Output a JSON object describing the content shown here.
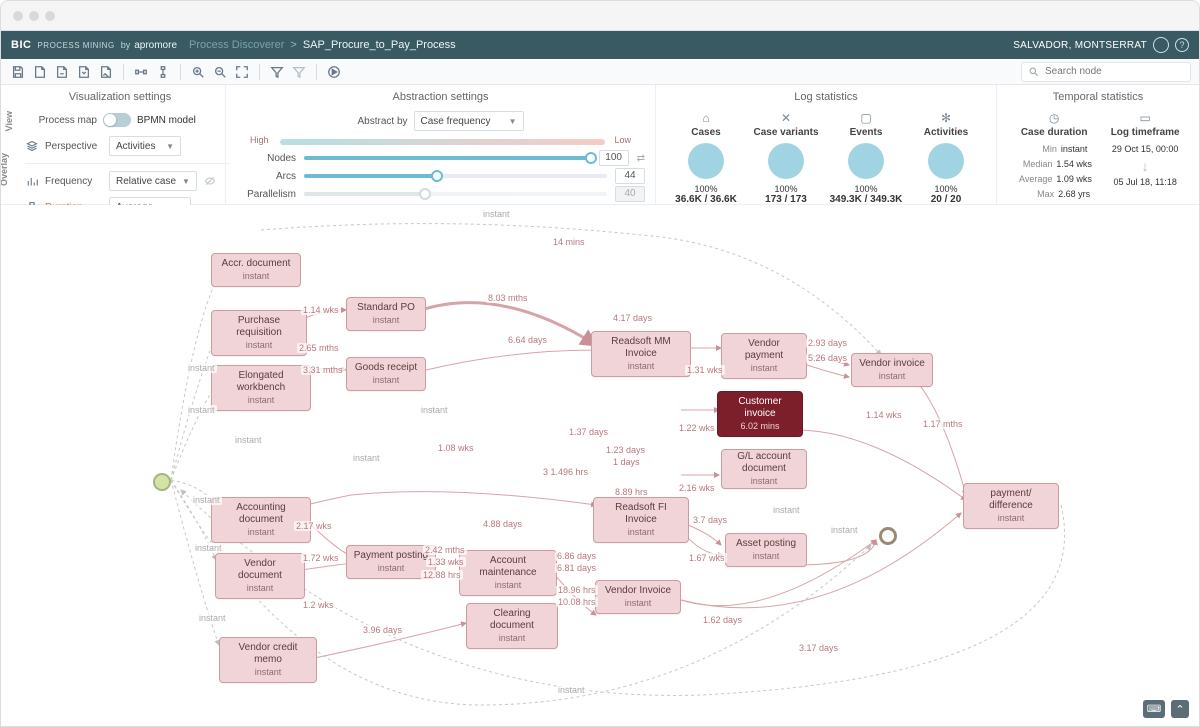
{
  "header": {
    "brand": "BIC",
    "brand_sub": "PROCESS MINING",
    "by": "by",
    "vendor": "apromore",
    "crumb1": "Process Discoverer",
    "crumb_sep": ">",
    "crumb2": "SAP_Procure_to_Pay_Process",
    "user": "SALVADOR, MONTSERRAT",
    "help": "?"
  },
  "toolbar": {
    "search_placeholder": "Search node"
  },
  "viz": {
    "title": "Visualization settings",
    "side_view": "View",
    "side_overlay": "Overlay",
    "process_map_label": "Process map",
    "bpmn_label": "BPMN model",
    "perspective_label": "Perspective",
    "perspective_value": "Activities",
    "frequency_label": "Frequency",
    "frequency_value": "Relative case",
    "duration_label": "Duration",
    "duration_value": "Average"
  },
  "abstr": {
    "title": "Abstraction settings",
    "abstract_by": "Abstract by",
    "abstract_by_value": "Case frequency",
    "high": "High",
    "low": "Low",
    "nodes_label": "Nodes",
    "nodes_value": "100",
    "arcs_label": "Arcs",
    "arcs_value": "44",
    "para_label": "Parallelism",
    "para_value": "40"
  },
  "logstats": {
    "title": "Log statistics",
    "cases": {
      "label": "Cases",
      "pct": "100%",
      "value": "36.6K / 36.6K"
    },
    "variants": {
      "label": "Case variants",
      "pct": "100%",
      "value": "173 / 173"
    },
    "events": {
      "label": "Events",
      "pct": "100%",
      "value": "349.3K / 349.3K"
    },
    "activities": {
      "label": "Activities",
      "pct": "100%",
      "value": "20 / 20"
    }
  },
  "temp": {
    "title": "Temporal statistics",
    "duration": {
      "label": "Case duration",
      "min_k": "Min",
      "min_v": "instant",
      "median_k": "Median",
      "median_v": "1.54 wks",
      "avg_k": "Average",
      "avg_v": "1.09 wks",
      "max_k": "Max",
      "max_v": "2.68 yrs"
    },
    "timeframe": {
      "label": "Log timeframe",
      "start": "29 Oct 15, 00:00",
      "end": "05 Jul 18, 11:18"
    }
  },
  "nodes": {
    "accr_doc": {
      "name": "Accr. document",
      "sub": "instant"
    },
    "purch_req": {
      "name": "Purchase requisition",
      "sub": "instant"
    },
    "elong_wb": {
      "name": "Elongated workbench",
      "sub": "instant"
    },
    "std_po": {
      "name": "Standard PO",
      "sub": "instant"
    },
    "goods_rec": {
      "name": "Goods receipt",
      "sub": "instant"
    },
    "acct_doc": {
      "name": "Accounting document",
      "sub": "instant"
    },
    "vendor_doc": {
      "name": "Vendor document",
      "sub": "instant"
    },
    "vendor_credit": {
      "name": "Vendor credit memo",
      "sub": "instant"
    },
    "pay_post": {
      "name": "Payment posting",
      "sub": "instant"
    },
    "acct_maint": {
      "name": "Account maintenance",
      "sub": "instant"
    },
    "clearing": {
      "name": "Clearing document",
      "sub": "instant"
    },
    "rs_mm": {
      "name": "Readsoft MM Invoice",
      "sub": "instant"
    },
    "rs_fi": {
      "name": "Readsoft FI Invoice",
      "sub": "instant"
    },
    "vendor_inv2": {
      "name": "Vendor Invoice",
      "sub": "instant"
    },
    "vendor_pay": {
      "name": "Vendor payment",
      "sub": "instant"
    },
    "cust_inv": {
      "name": "Customer invoice",
      "sub": "6.02 mins"
    },
    "gl_acct": {
      "name": "G/L account document",
      "sub": "instant"
    },
    "asset_post": {
      "name": "Asset posting",
      "sub": "instant"
    },
    "vendor_inv": {
      "name": "Vendor invoice",
      "sub": "instant"
    },
    "pay_diff": {
      "name": "payment/ difference",
      "sub": "instant"
    }
  },
  "edges": {
    "e1": "1.14 wks",
    "e2": "2.65 mths",
    "e3": "3.31 mths",
    "e4": "8.03 mths",
    "e5": "6.64 days",
    "e6": "4.17 days",
    "e7": "2.93 days",
    "e8": "5.26 days",
    "e9": "1.31 wks",
    "e10": "1.22 wks",
    "e11": "2.16 wks",
    "e12": "3.7 days",
    "e13": "1.67 wks",
    "e14": "1.62 days",
    "e15": "3.17 days",
    "e16": "1.08 wks",
    "e17": "1.37 days",
    "e18": "1.23 days",
    "e19": "1 days",
    "e20": "8.89 hrs",
    "e21": "2.17 wks",
    "e22": "1.72 wks",
    "e23": "2.42 mths",
    "e24": "1.33 wks",
    "e25": "12.88 hrs",
    "e26": "4.88 days",
    "e27": "6.86 days",
    "e28": "6.81 days",
    "e29": "3 1.496 hrs",
    "e30": "10.08 hrs",
    "e31": "18.96 hrs",
    "e32": "1.14 wks",
    "e33": "1.17 mths",
    "e34": "14 mins",
    "e35": "instant",
    "e36": "instant",
    "e37": "instant",
    "e38": "instant",
    "e39": "instant",
    "e40": "instant",
    "e41": "instant",
    "e42": "instant",
    "e43": "1.2 wks",
    "e44": "3.96 days",
    "e45": "instant",
    "e46": "instant",
    "e47": "instant",
    "e48": "instant"
  }
}
